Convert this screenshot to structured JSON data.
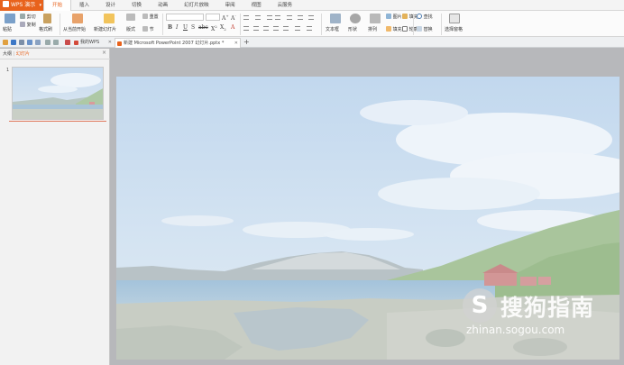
{
  "app": {
    "name": "WPS 演示"
  },
  "menu_tabs": [
    "开始",
    "插入",
    "设计",
    "切换",
    "动画",
    "幻灯片放映",
    "审阅",
    "视图",
    "云服务"
  ],
  "ribbon": {
    "paste": "粘贴",
    "cut": "剪切",
    "copy": "复制",
    "format_painter": "格式刷",
    "from_current": "从当前开始",
    "new_slide": "新建幻灯片",
    "layout": "版式",
    "section": "节",
    "reset": "重置",
    "text_box": "文本框",
    "shape": "形状",
    "arrange": "排列",
    "picture": "图片",
    "fill": "填充",
    "outline": "轮廓",
    "find": "查找",
    "replace": "替换",
    "select_pane": "选择窗格"
  },
  "doc_tabs": [
    {
      "label": "我的WPS"
    },
    {
      "label": "新建 Microsoft PowerPoint 2007 幻灯片.pptx *"
    }
  ],
  "left_pane": {
    "outline_tab": "大纲",
    "slides_tab": "幻灯片",
    "slide_number": "1"
  },
  "watermark": {
    "glyph": "S",
    "title": "搜狗指南",
    "url": "zhinan.sogou.com"
  },
  "colors": {
    "accent": "#e8621c",
    "workspace": "#b7b8bb",
    "sky": "#c8dcef",
    "water": "#9fbfd8"
  }
}
